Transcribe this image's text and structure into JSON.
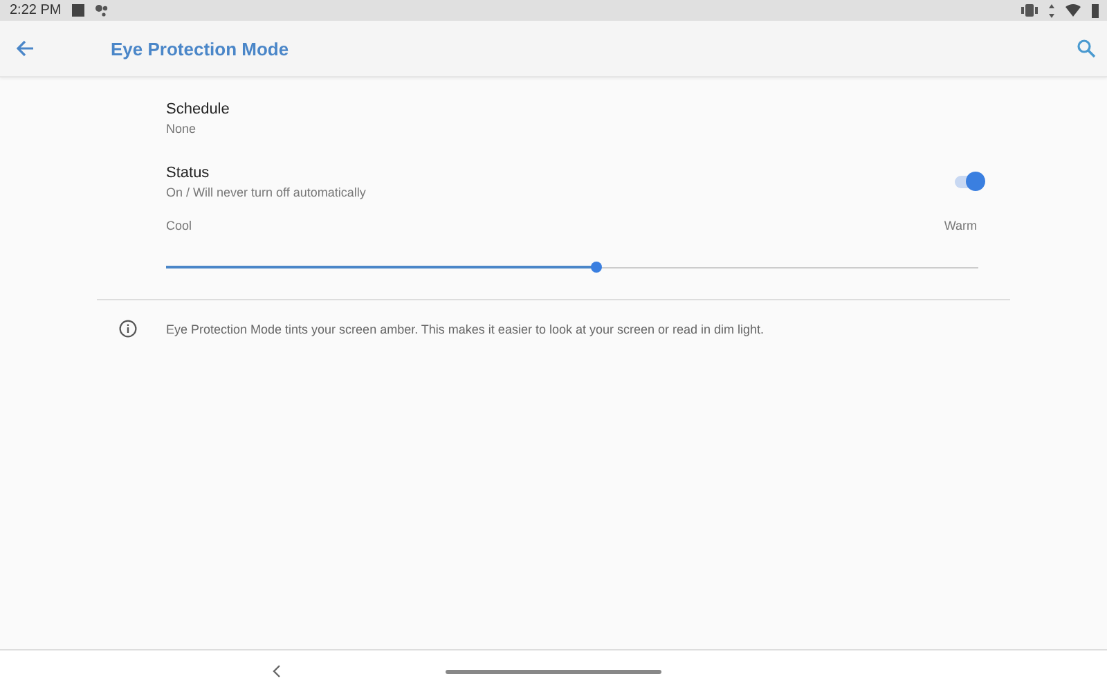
{
  "status_bar": {
    "time": "2:22 PM"
  },
  "app_bar": {
    "title": "Eye Protection Mode"
  },
  "settings": [
    {
      "kind": "text",
      "title": "Schedule",
      "summary": "None"
    },
    {
      "kind": "toggle",
      "title": "Status",
      "summary": "On / Will never turn off automatically",
      "on": true
    }
  ],
  "temperature": {
    "min_label": "Cool",
    "max_label": "Warm",
    "level": 0.53
  },
  "info": {
    "text": "Eye Protection Mode tints your screen amber. This makes it easier to look at your screen or read in dim light."
  }
}
